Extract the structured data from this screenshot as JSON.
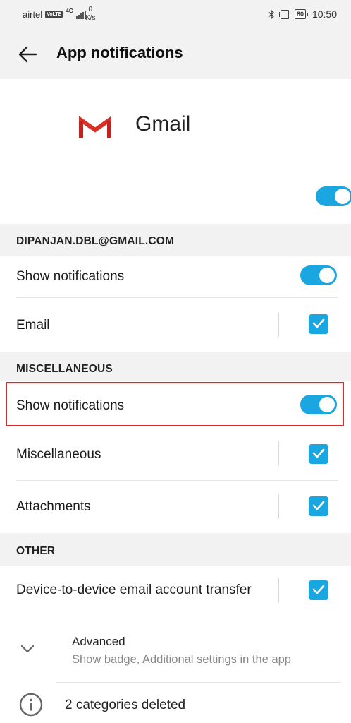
{
  "status_bar": {
    "carrier": "airtel",
    "volte_badge": "VoLTE",
    "network_type": "4G",
    "speed_value": "0",
    "speed_unit": "K/s",
    "battery": "80",
    "time": "10:50",
    "icons": [
      "bluetooth-icon",
      "vibrate-icon",
      "battery-icon",
      "signal-icon"
    ]
  },
  "app_bar": {
    "title": "App notifications",
    "back_icon": "arrow-left-icon"
  },
  "app": {
    "name": "Gmail",
    "icon": "gmail-logo",
    "master_toggle_on": true
  },
  "sections": {
    "account": {
      "header": "DIPANJAN.DBL@GMAIL.COM",
      "show_notifications_label": "Show notifications",
      "show_notifications_on": true,
      "email_label": "Email",
      "email_checked": true
    },
    "misc": {
      "header": "MISCELLANEOUS",
      "show_notifications_label": "Show notifications",
      "show_notifications_on": true,
      "miscellaneous_label": "Miscellaneous",
      "miscellaneous_checked": true,
      "attachments_label": "Attachments",
      "attachments_checked": true
    },
    "other": {
      "header": "OTHER",
      "transfer_label": "Device-to-device email account transfer",
      "transfer_checked": true
    }
  },
  "advanced": {
    "title": "Advanced",
    "subtitle": "Show badge, Additional settings in the app"
  },
  "info": {
    "text": "2 categories deleted"
  },
  "colors": {
    "accent": "#1aa6e0",
    "highlight_border": "#d62b2b",
    "section_bg": "#f2f2f2",
    "gmail_red": "#d93025"
  }
}
